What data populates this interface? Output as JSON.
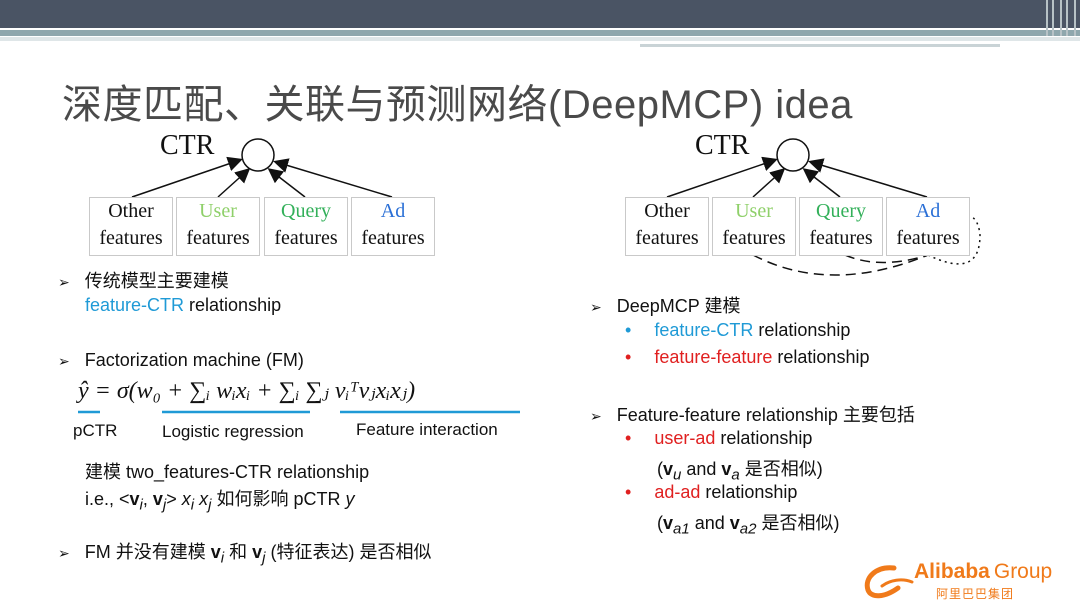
{
  "title": "深度匹配、关联与预测网络(DeepMCP) idea",
  "diagram_left": {
    "ctr": "CTR",
    "boxes": [
      {
        "line1": "Other",
        "line2": "features"
      },
      {
        "line1": "User",
        "line2": "features"
      },
      {
        "line1": "Query",
        "line2": "features"
      },
      {
        "line1": "Ad",
        "line2": "features"
      }
    ]
  },
  "diagram_right": {
    "ctr": "CTR",
    "boxes": [
      {
        "line1": "Other",
        "line2": "features"
      },
      {
        "line1": "User",
        "line2": "features"
      },
      {
        "line1": "Query",
        "line2": "features"
      },
      {
        "line1": "Ad",
        "line2": "features"
      }
    ]
  },
  "left": {
    "b1_marker": "➢",
    "b1_text": "传统模型主要建模",
    "b1_sub_colored": "feature-CTR",
    "b1_sub_rest": " relationship",
    "b2_marker": "➢",
    "b2_text": "Factorization machine (FM)",
    "formula": "ŷ = σ(w₀ + ∑ᵢ wᵢxᵢ + ∑ᵢ ∑ⱼ vᵢᵀvⱼxᵢxⱼ)",
    "lbl_pctr": "pCTR",
    "lbl_lr": "Logistic regression",
    "lbl_fi": "Feature interaction",
    "b2_sub1": "建模 two_features-CTR relationship",
    "b2_sub2_a": "i.e., <",
    "b2_sub2_vi": "v",
    "b2_sub2_i": "i",
    "b2_sub2_comma": ", ",
    "b2_sub2_vj": "v",
    "b2_sub2_j": "j",
    "b2_sub2_b": "> ",
    "b2_sub2_xi": "x",
    "b2_sub2_xj": "x",
    "b2_sub2_c": " 如何影响 pCTR ",
    "b2_sub2_y": "y",
    "b3_marker": "➢",
    "b3_a": "FM 并没有建模 ",
    "b3_vi": "v",
    "b3_i": "i",
    "b3_and": " 和 ",
    "b3_vj": "v",
    "b3_j": "j",
    "b3_b": " (特征表达) 是否相似"
  },
  "right": {
    "b1_marker": "➢",
    "b1_text": "DeepMCP 建模",
    "items1": [
      {
        "bullet": "•",
        "colored": "feature-CTR",
        "rest": " relationship",
        "color": "blue"
      },
      {
        "bullet": "•",
        "colored": "feature-feature",
        "rest": " relationship",
        "color": "red"
      }
    ],
    "b2_marker": "➢",
    "b2_text": "Feature-feature relationship 主要包括",
    "i1_bullet": "•",
    "i1_colored": "user-ad",
    "i1_rest": " relationship",
    "i1_sub_a": "(",
    "i1_sub_v1": "v",
    "i1_sub_s1": "u",
    "i1_sub_and": " and ",
    "i1_sub_v2": "v",
    "i1_sub_s2": "a",
    "i1_sub_b": " 是否相似)",
    "i2_bullet": "•",
    "i2_colored": "ad-ad",
    "i2_rest": " relationship",
    "i2_sub_a": "(",
    "i2_sub_v1": "v",
    "i2_sub_s1": "a1",
    "i2_sub_and": " and ",
    "i2_sub_v2": "v",
    "i2_sub_s2": "a2",
    "i2_sub_b": " 是否相似)"
  },
  "logo": {
    "name": "Alibaba",
    "group": "Group",
    "chinese": "阿里巴巴集团"
  },
  "colors": {
    "blue": "#1f9ad6",
    "red": "#e02020",
    "orange": "#f07a1a",
    "header": "#4a5464"
  }
}
